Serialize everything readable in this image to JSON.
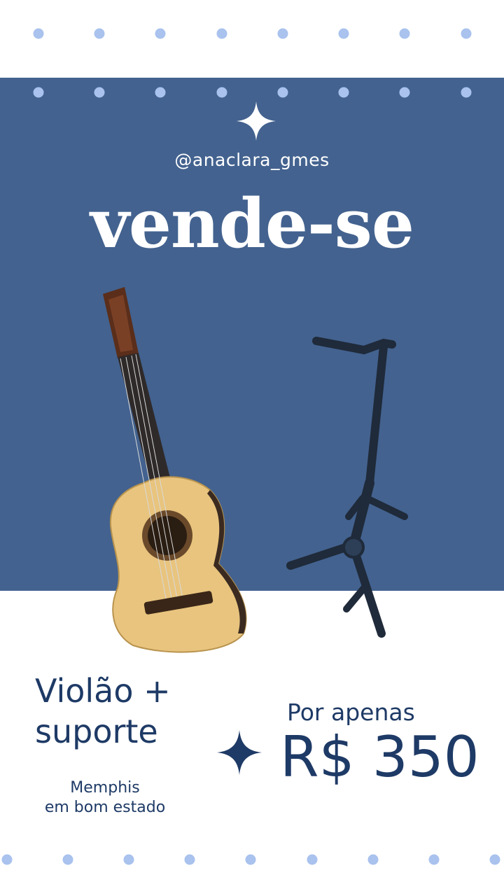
{
  "handle": "@anaclara_gmes",
  "title": "vende-se",
  "product": {
    "line1": "Violão +",
    "line2": "suporte"
  },
  "details": {
    "line1": "Memphis",
    "line2": "em bom estado"
  },
  "price": {
    "prefix": "Por apenas",
    "value": "R$ 350"
  },
  "colors": {
    "panel": "#43628f",
    "dots": "#a9c2ee",
    "text": "#1e3a66",
    "guitar_body": "#e8c47e"
  },
  "icons": [
    "sparkle-icon",
    "guitar-photo",
    "guitar-stand-photo"
  ]
}
